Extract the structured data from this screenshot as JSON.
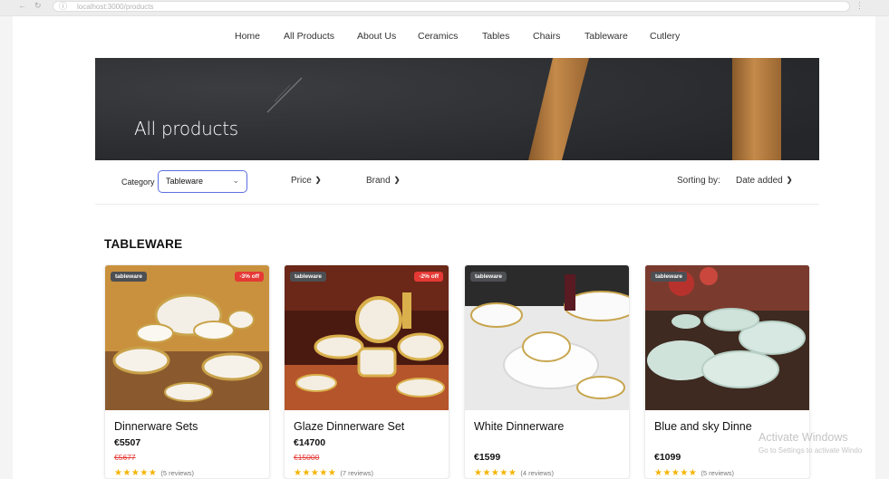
{
  "browser": {
    "url": "localhost:3000/products"
  },
  "nav": [
    "Home",
    "All Products",
    "About Us",
    "Ceramics",
    "Tables",
    "Chairs",
    "Tableware",
    "Cutlery"
  ],
  "hero": {
    "title": "All products"
  },
  "filters": {
    "category_label": "Category",
    "category_value": "Tableware",
    "price_label": "Price",
    "brand_label": "Brand",
    "sorting_label": "Sorting by:",
    "sorting_value": "Date added"
  },
  "section_title": "TABLEWARE",
  "products": [
    {
      "category": "tableware",
      "discount": "-3% off",
      "name": "Dinnerware Sets",
      "price": "€5507",
      "old_price": "€5677",
      "rating": "★★★★★",
      "reviews": "(5 reviews)"
    },
    {
      "category": "tableware",
      "discount": "-2% off",
      "name": "Glaze Dinnerware Set",
      "price": "€14700",
      "old_price": "€15000",
      "rating": "★★★★★",
      "reviews": "(7 reviews)"
    },
    {
      "category": "tableware",
      "discount": "",
      "name": "White Dinnerware",
      "price": "€1599",
      "old_price": "",
      "rating": "★★★★★",
      "reviews": "(4 reviews)"
    },
    {
      "category": "tableware",
      "discount": "",
      "name": "Blue and sky Dinne",
      "price": "€1099",
      "old_price": "",
      "rating": "★★★★★",
      "reviews": "(5 reviews)"
    }
  ],
  "watermark": {
    "title": "Activate Windows",
    "subtitle": "Go to Settings to activate Windo"
  },
  "colors": {
    "accent": "#5b6ee1",
    "discount": "#e53935",
    "star": "#f5b400",
    "hero_bg": "#2c2e30"
  }
}
